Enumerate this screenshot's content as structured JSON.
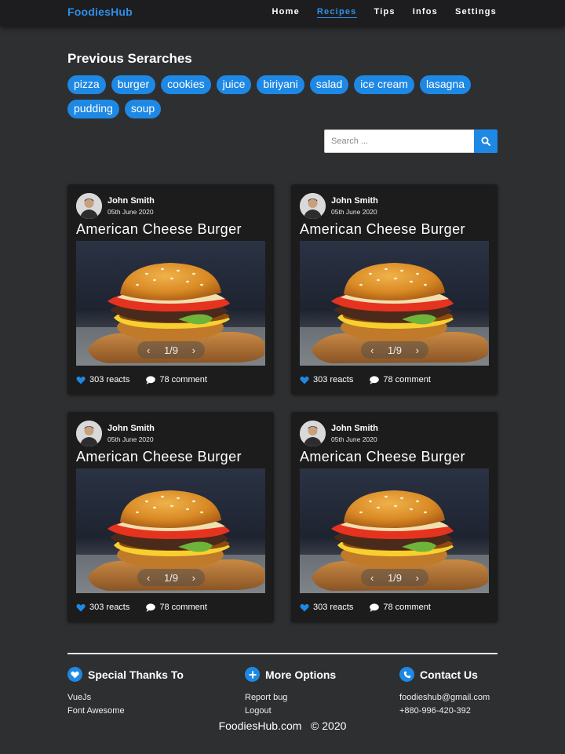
{
  "brand": {
    "part1": "Foo",
    "part2": "diesHub"
  },
  "nav": [
    "Home",
    "Recipes",
    "Tips",
    "Infos",
    "Settings"
  ],
  "active_nav": "Recipes",
  "previous_searches": {
    "title": "Previous Serarches",
    "tags": [
      "pizza",
      "burger",
      "cookies",
      "juice",
      "biriyani",
      "salad",
      "ice cream",
      "lasagna",
      "pudding",
      "soup"
    ]
  },
  "search": {
    "placeholder": "Search ..."
  },
  "cards": [
    {
      "author": "John Smith",
      "date": "05th June 2020",
      "title": "American Cheese Burger",
      "slide": "1/9",
      "reacts": "303 reacts",
      "comments": "78 comment"
    },
    {
      "author": "John Smith",
      "date": "05th June 2020",
      "title": "American Cheese Burger",
      "slide": "1/9",
      "reacts": "303 reacts",
      "comments": "78 comment"
    },
    {
      "author": "John Smith",
      "date": "05th June 2020",
      "title": "American Cheese Burger",
      "slide": "1/9",
      "reacts": "303 reacts",
      "comments": "78 comment"
    },
    {
      "author": "John Smith",
      "date": "05th June 2020",
      "title": "American Cheese Burger",
      "slide": "1/9",
      "reacts": "303 reacts",
      "comments": "78 comment"
    }
  ],
  "footer": {
    "thanks": {
      "title": "Special Thanks To",
      "items": [
        "VueJs",
        "Font Awesome"
      ]
    },
    "options": {
      "title": "More Options",
      "items": [
        "Report bug",
        "Logout"
      ]
    },
    "contact": {
      "title": "Contact Us",
      "items": [
        "foodieshub@gmail.com",
        "+880-996-420-392"
      ]
    },
    "copyright": "FoodiesHub.com   © 2020"
  },
  "colors": {
    "accent": "#1e88e5",
    "background": "#2e2f31",
    "card": "#1c1c1d",
    "navbar": "#1d1d1f"
  },
  "icons": [
    "search-icon",
    "heart-icon",
    "comment-icon",
    "chevron-left-icon",
    "chevron-right-icon",
    "heart-circle-icon",
    "plus-circle-icon",
    "phone-circle-icon"
  ]
}
